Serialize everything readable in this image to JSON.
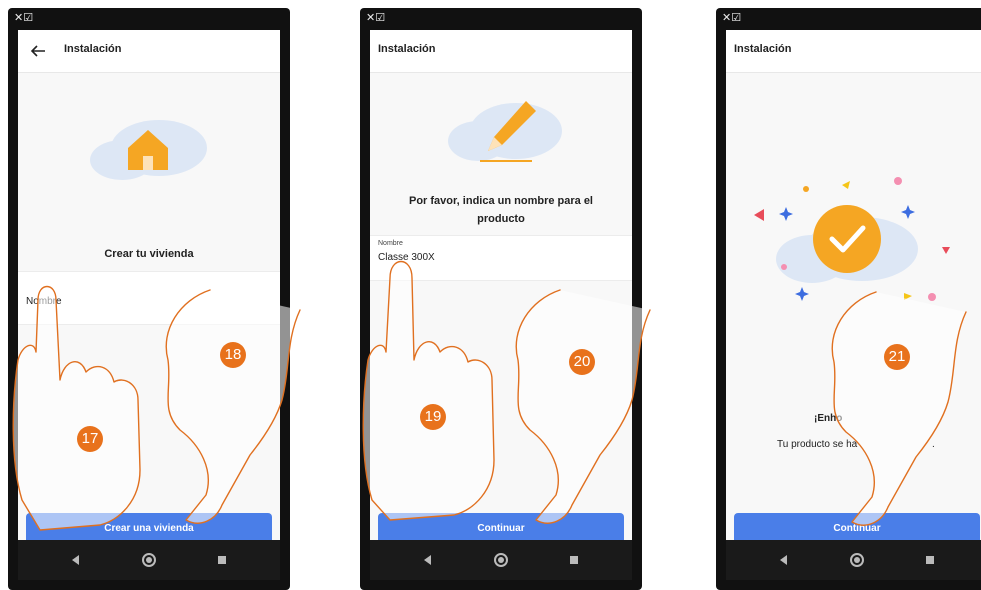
{
  "screens": [
    {
      "status_text": "✕☑",
      "header": {
        "title": "Instalación",
        "has_back": true
      },
      "heading": "Crear tu vivienda",
      "field": {
        "label": "Nombre"
      },
      "button": "Crear una vivienda",
      "step_left": "17",
      "step_right": "18"
    },
    {
      "status_text": "✕☑",
      "header": {
        "title": "Instalación",
        "has_back": false
      },
      "heading_line1": "Por favor, indica un nombre para el",
      "heading_line2": "producto",
      "field": {
        "small_label": "Nombre",
        "value": "Classe 300X"
      },
      "button": "Continuar",
      "step_left": "19",
      "step_right": "20"
    },
    {
      "status_text": "✕☑",
      "header": {
        "title": "Instalación",
        "has_back": false
      },
      "message_title": "¡Enho",
      "message_body_start": "Tu producto se ha",
      "message_body_end": ".",
      "button": "Continuar",
      "step": "21"
    }
  ],
  "colors": {
    "accent": "#4a7ee8",
    "orange": "#f5a623",
    "hand_stroke": "#e07020",
    "badge": "#e8721c"
  },
  "nav_icons": [
    "back-triangle-icon",
    "home-circle-icon",
    "recents-square-icon"
  ]
}
